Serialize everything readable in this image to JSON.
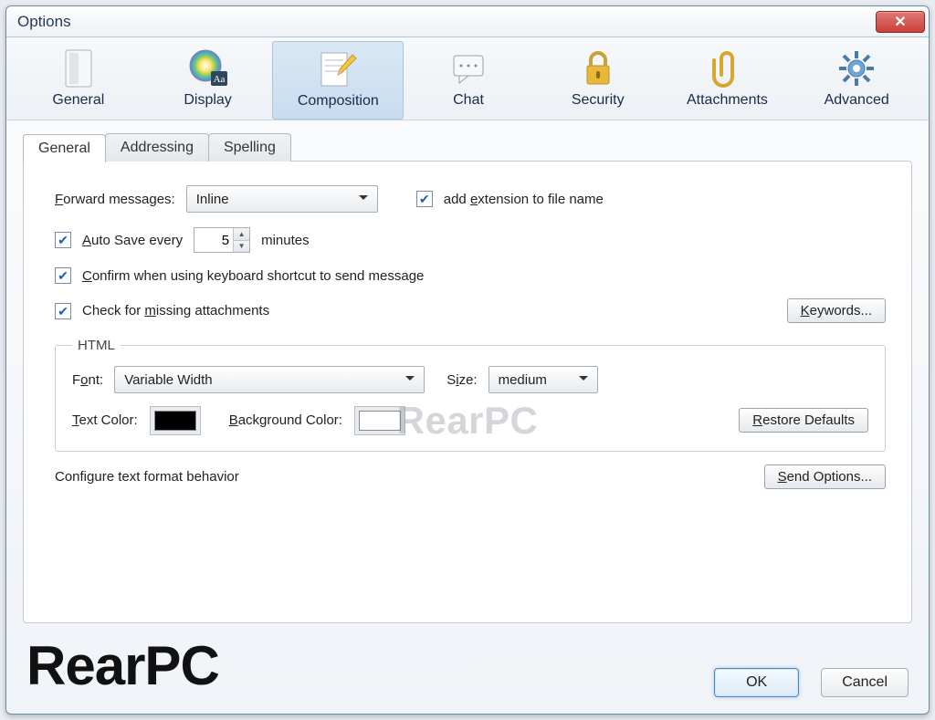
{
  "window": {
    "title": "Options"
  },
  "categories": [
    {
      "label": "General"
    },
    {
      "label": "Display"
    },
    {
      "label": "Composition",
      "selected": true
    },
    {
      "label": "Chat"
    },
    {
      "label": "Security"
    },
    {
      "label": "Attachments"
    },
    {
      "label": "Advanced"
    }
  ],
  "tabs": [
    {
      "label": "General",
      "active": true
    },
    {
      "label": "Addressing"
    },
    {
      "label": "Spelling"
    }
  ],
  "general": {
    "forward_label": "Forward messages:",
    "forward_value": "Inline",
    "add_extension_label": "add extension to file name",
    "add_extension_checked": true,
    "autosave_label_pre": "Auto Save every",
    "autosave_value": "5",
    "autosave_label_post": "minutes",
    "autosave_checked": true,
    "confirm_send_label": "Confirm when using keyboard shortcut to send message",
    "confirm_send_checked": true,
    "check_attachments_label": "Check for missing attachments",
    "check_attachments_checked": true,
    "keywords_btn": "Keywords..."
  },
  "html": {
    "legend": "HTML",
    "font_label": "Font:",
    "font_value": "Variable Width",
    "size_label": "Size:",
    "size_value": "medium",
    "text_color_label": "Text Color:",
    "text_color": "#000000",
    "bg_color_label": "Background Color:",
    "bg_color": "#ffffff",
    "restore_btn": "Restore Defaults"
  },
  "configure": {
    "label": "Configure text format behavior",
    "send_options_btn": "Send Options..."
  },
  "buttons": {
    "ok": "OK",
    "cancel": "Cancel"
  },
  "watermark": "RearPC"
}
